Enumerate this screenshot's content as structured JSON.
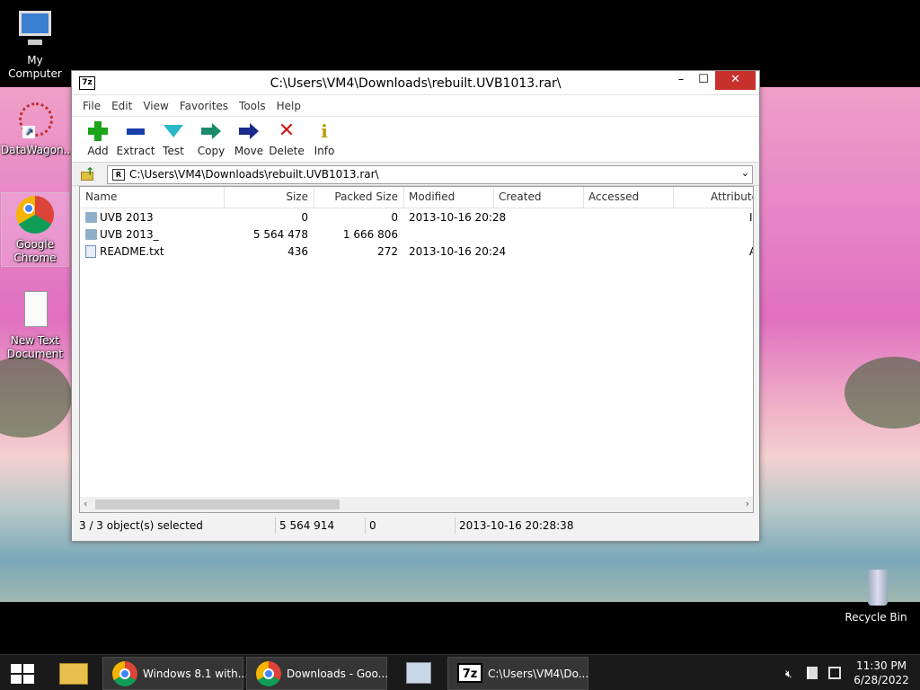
{
  "desktop": {
    "icons": [
      {
        "label": "My Computer"
      },
      {
        "label": "DataWagon..."
      },
      {
        "label": "Google Chrome"
      },
      {
        "label": "New Text Document"
      },
      {
        "label": "Recycle Bin"
      }
    ]
  },
  "window": {
    "app_icon_text": "7z",
    "title": "C:\\Users\\VM4\\Downloads\\rebuilt.UVB1013.rar\\",
    "minimize": "–",
    "maximize": "☐",
    "close": "✕"
  },
  "menu": [
    "File",
    "Edit",
    "View",
    "Favorites",
    "Tools",
    "Help"
  ],
  "toolbar": [
    {
      "label": "Add",
      "icon": "add-icon",
      "color": "#1aa51a"
    },
    {
      "label": "Extract",
      "icon": "extract-icon",
      "color": "#1a3ea8"
    },
    {
      "label": "Test",
      "icon": "test-icon",
      "color": "#2bb8c8"
    },
    {
      "label": "Copy",
      "icon": "copy-icon",
      "color": "#1a8a6a"
    },
    {
      "label": "Move",
      "icon": "move-icon",
      "color": "#1a2a8a"
    },
    {
      "label": "Delete",
      "icon": "delete-icon",
      "color": "#d01818"
    },
    {
      "label": "Info",
      "icon": "info-icon",
      "color": "#d8c000"
    }
  ],
  "address": {
    "path": "C:\\Users\\VM4\\Downloads\\rebuilt.UVB1013.rar\\",
    "dropdown": "⌄"
  },
  "columns": [
    "Name",
    "Size",
    "Packed Size",
    "Modified",
    "Created",
    "Accessed",
    "Attribute"
  ],
  "files": [
    {
      "name": "UVB 2013",
      "type": "folder",
      "size": "0",
      "packed": "0",
      "modified": "2013-10-16 20:28",
      "attr": "I"
    },
    {
      "name": "UVB 2013_",
      "type": "folder",
      "size": "5 564 478",
      "packed": "1 666 806",
      "modified": "",
      "attr": ""
    },
    {
      "name": "README.txt",
      "type": "file",
      "size": "436",
      "packed": "272",
      "modified": "2013-10-16 20:24",
      "attr": "A"
    }
  ],
  "status": {
    "selected": "3 / 3 object(s) selected",
    "size": "5 564 914",
    "packed": "0",
    "modified": "2013-10-16 20:28:38"
  },
  "taskbar": {
    "items": [
      {
        "label": "Windows 8.1 with..."
      },
      {
        "label": "Downloads - Goo..."
      },
      {
        "label": "C:\\Users\\VM4\\Do..."
      }
    ],
    "time": "11:30 PM",
    "date": "6/28/2022"
  }
}
